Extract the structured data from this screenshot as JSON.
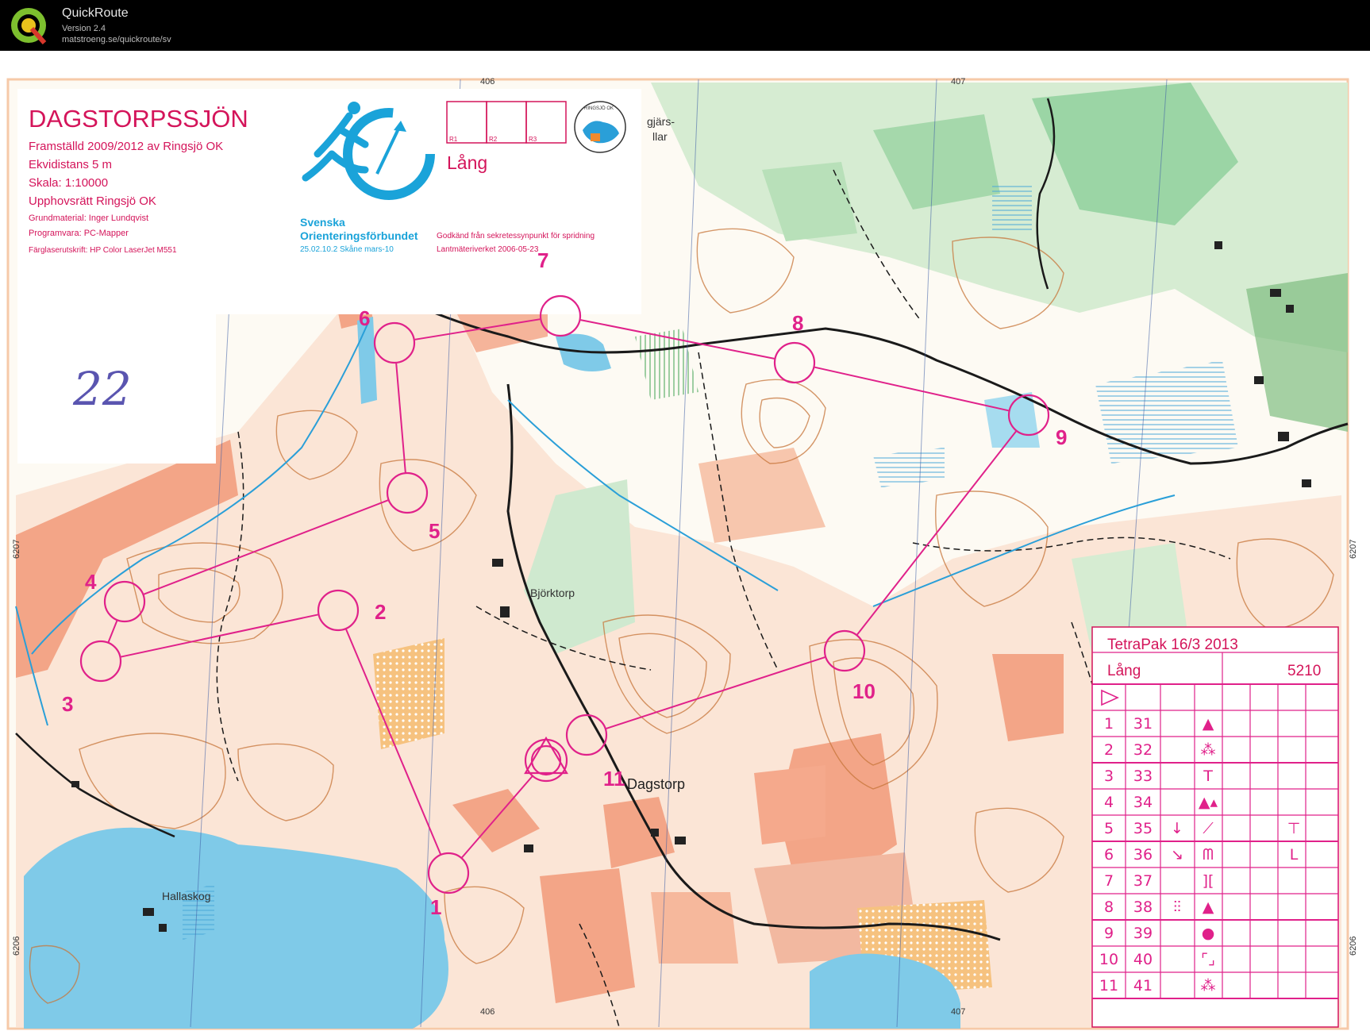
{
  "app": {
    "name": "QuickRoute",
    "version": "Version 2.4",
    "url": "matstroeng.se/quickroute/sv"
  },
  "map": {
    "title": "DAGSTORPSSJÖN",
    "info_lines": [
      "Framställd 2009/2012 av Ringsjö OK",
      "Ekvidistans 5 m",
      "Skala:    1:10000",
      "Upphovsrätt Ringsjö OK"
    ],
    "info_small": [
      "Grundmaterial: Inger Lundqvist",
      "Programvara: PC-Mapper",
      "Färglaserutskrift: HP Color LaserJet M551"
    ],
    "federation_line1": "Svenska",
    "federation_line2": "Orienteringsförbundet",
    "federation_line3": "25.02.10.2 Skåne mars-10",
    "approval_line1": "Godkänd från sekretessynpunkt för spridning",
    "approval_line2": "Lantmäteriverket 2006-05-23",
    "course_boxes": [
      "R1",
      "R2",
      "R3"
    ],
    "course_label": "Lång",
    "club_logo_text": "RINGSJÖ OK",
    "handwritten": "22",
    "grid_labels": {
      "top": [
        "406",
        "407"
      ],
      "bottom": [
        "406",
        "407"
      ],
      "left": [
        "6207",
        "6206"
      ],
      "right": [
        "6207",
        "6206"
      ]
    },
    "place_names": [
      "Björktorp",
      "Dagstorp",
      "Hallaskog",
      "gjärs-",
      "llar"
    ],
    "colors": {
      "course": "#e0218a",
      "water": "#8fd3ec",
      "forest_green": "#7cc48d",
      "open_orange": "#f4a58a",
      "contour": "#c7753a",
      "title_red": "#d4145a",
      "logo_blue": "#1aa3d9"
    }
  },
  "course": {
    "control_labels": [
      "1",
      "2",
      "3",
      "4",
      "5",
      "6",
      "7",
      "8",
      "9",
      "10",
      "11"
    ]
  },
  "description_sheet": {
    "event": "TetraPak 16/3 2013",
    "course": "Lång",
    "length": "5210",
    "rows": [
      {
        "no": "1",
        "code": "31",
        "d": "",
        "e": "▲",
        "g": ""
      },
      {
        "no": "2",
        "code": "32",
        "d": "",
        "e": "⁂",
        "g": ""
      },
      {
        "no": "3",
        "code": "33",
        "d": "",
        "e": "T",
        "g": ""
      },
      {
        "no": "4",
        "code": "34",
        "d": "",
        "e": "▲▴",
        "g": ""
      },
      {
        "no": "5",
        "code": "35",
        "d": "↓",
        "e": "⟋",
        "g": "⊤"
      },
      {
        "no": "6",
        "code": "36",
        "d": "↘",
        "e": "ᗰ",
        "g": "L"
      },
      {
        "no": "7",
        "code": "37",
        "d": "",
        "e": "][",
        "g": ""
      },
      {
        "no": "8",
        "code": "38",
        "d": "⫶⫶",
        "e": "▲",
        "g": ""
      },
      {
        "no": "9",
        "code": "39",
        "d": "",
        "e": "●",
        "g": ""
      },
      {
        "no": "10",
        "code": "40",
        "d": "",
        "e": "⌜⌟",
        "g": ""
      },
      {
        "no": "11",
        "code": "41",
        "d": "",
        "e": "⁂",
        "g": ""
      }
    ]
  }
}
